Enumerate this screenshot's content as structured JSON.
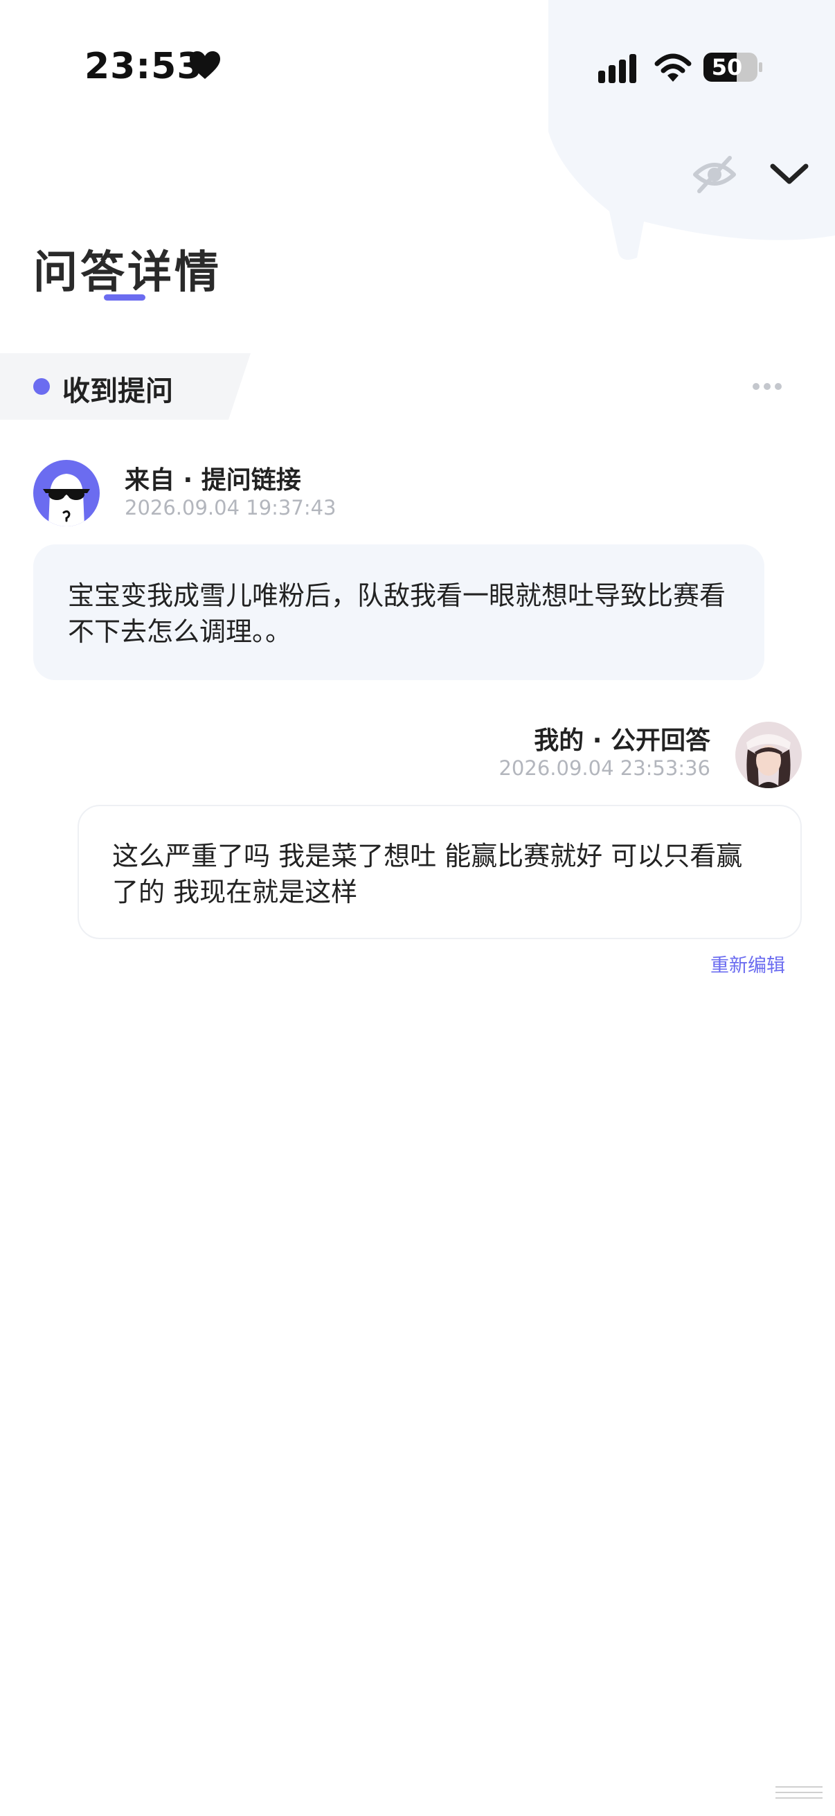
{
  "status_bar": {
    "time": "23:53",
    "battery": "50",
    "icons": [
      "heart-icon",
      "signal-icon",
      "wifi-icon",
      "battery-icon"
    ]
  },
  "header": {
    "title": "问答详情",
    "icons": [
      "eye-off-icon",
      "chevron-down-icon"
    ]
  },
  "section": {
    "label": "收到提问",
    "menu_icon": "more-horizontal-icon"
  },
  "question": {
    "source": "来自 · 提问链接",
    "time": "2026.09.04 19:37:43",
    "text": "宝宝变我成雪儿唯粉后，队敌我看一眼就想吐导致比赛看不下去怎么调理。。"
  },
  "answer": {
    "source": "我的 · 公开回答",
    "time": "2026.09.04 23:53:36",
    "text": "这么严重了吗 我是菜了想吐 能赢比赛就好 可以只看赢了的 我现在就是这样",
    "edit_label": "重新编辑"
  },
  "colors": {
    "accent": "#6b6cf0",
    "question_bubble": "#f3f6fb",
    "header_bubble": "#f3f6fb",
    "meta_text": "#b3b6bd"
  }
}
